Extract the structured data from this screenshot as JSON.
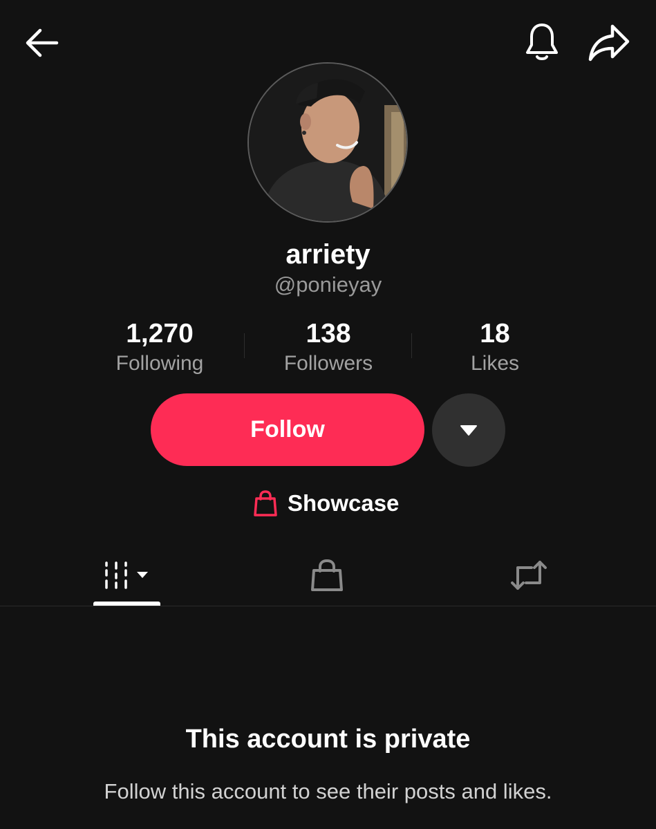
{
  "header": {
    "back_icon": "arrow-left-icon",
    "notify_icon": "bell-icon",
    "share_icon": "share-arrow-icon"
  },
  "profile": {
    "display_name": "arriety",
    "username": "@ponieyay",
    "avatar": "profile-photo"
  },
  "stats": [
    {
      "value": "1,270",
      "label": "Following"
    },
    {
      "value": "138",
      "label": "Followers"
    },
    {
      "value": "18",
      "label": "Likes"
    }
  ],
  "actions": {
    "follow_label": "Follow",
    "more_icon": "caret-down-icon",
    "showcase_label": "Showcase",
    "showcase_icon": "shopping-bag-icon"
  },
  "tabs": [
    {
      "icon": "grid-columns-icon",
      "active": true
    },
    {
      "icon": "shopping-bag-icon",
      "active": false
    },
    {
      "icon": "repost-icon",
      "active": false
    }
  ],
  "private_notice": {
    "title": "This account is private",
    "subtitle": "Follow this account to see their posts and likes."
  },
  "colors": {
    "background": "#121212",
    "accent": "#fe2c55",
    "secondary_text": "#a2a2a2",
    "more_button": "#303030"
  }
}
